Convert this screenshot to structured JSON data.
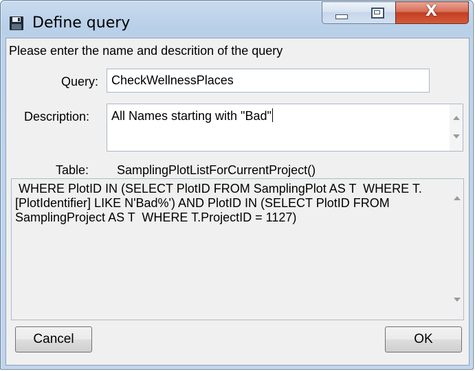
{
  "window": {
    "title": "Define query",
    "icon": "floppy-disk-icon",
    "buttons": {
      "minimize": "minimize",
      "maximize": "maximize",
      "close": "X"
    }
  },
  "form": {
    "instruction": "Please enter the name and descrition of the query",
    "query_label": "Query:",
    "query_value": "CheckWellnessPlaces",
    "description_label": "Description:",
    "description_value": "All Names starting with \"Bad\"",
    "table_label": "Table:",
    "table_value": "SamplingPlotListForCurrentProject()"
  },
  "sql": {
    "text": " WHERE PlotID IN (SELECT PlotID FROM SamplingPlot AS T  WHERE T.[PlotIdentifier] LIKE N'Bad%') AND PlotID IN (SELECT PlotID FROM SamplingProject AS T  WHERE T.ProjectID = 1127)"
  },
  "footer": {
    "cancel_label": "Cancel",
    "ok_label": "OK"
  }
}
